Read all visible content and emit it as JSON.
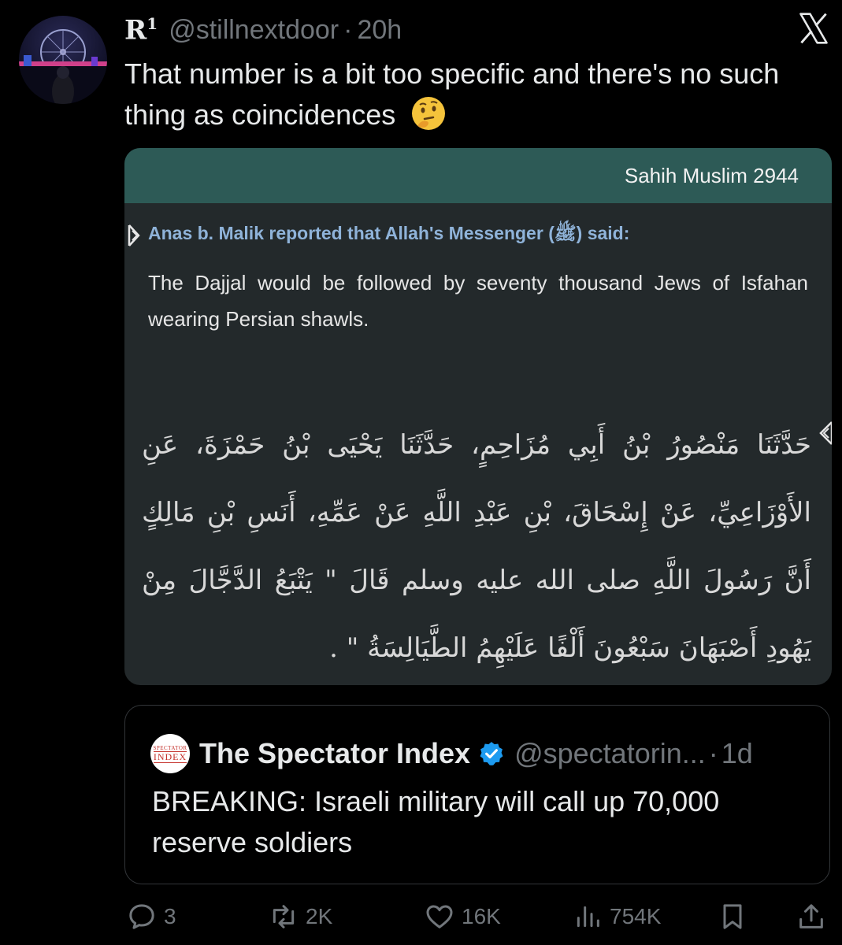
{
  "tweet": {
    "author_name": "R",
    "author_sup": "1",
    "handle": "@stillnextdoor",
    "time": "20h",
    "text": "That number is a bit too specific and there's no such thing as coincidences",
    "emoji": "thinking-face-icon"
  },
  "hadith_card": {
    "source": "Sahih Muslim 2944",
    "narrator": "Anas b. Malik reported that Allah's Messenger (ﷺ) said:",
    "english": "The Dajjal would be followed by seventy thousand Jews of Isfahan wearing Persian shawls.",
    "arabic": "حَدَّثَنَا مَنْصُورُ بْنُ أَبِي مُزَاحِمٍ، حَدَّثَنَا يَحْيَى بْنُ حَمْزَةَ، عَنِ الأَوْزَاعِيِّ، عَنْ إِسْحَاقَ، بْنِ عَبْدِ اللَّهِ عَنْ عَمِّهِ، أَنَسِ بْنِ مَالِكٍ أَنَّ رَسُولَ اللَّهِ صلى الله عليه وسلم قَالَ \" يَتْبَعُ الدَّجَّالَ مِنْ يَهُودِ أَصْبَهَانَ سَبْعُونَ أَلْفًا عَلَيْهِمُ الطَّيَالِسَةُ \" ."
  },
  "quote": {
    "logo_top": "SPECTATOR",
    "logo_bottom": "INDEX",
    "name": "The Spectator Index",
    "handle": "@spectatorin...",
    "time": "1d",
    "text": "BREAKING: Israeli military will call up 70,000 reserve soldiers"
  },
  "actions": {
    "replies": "3",
    "reposts": "2K",
    "likes": "16K",
    "views": "754K"
  },
  "colors": {
    "background": "#000000",
    "card": "#23292b",
    "card_header": "#2d5a56",
    "narrator": "#8fb3d9",
    "verified": "#1d9bf0",
    "muted": "#71767b"
  }
}
